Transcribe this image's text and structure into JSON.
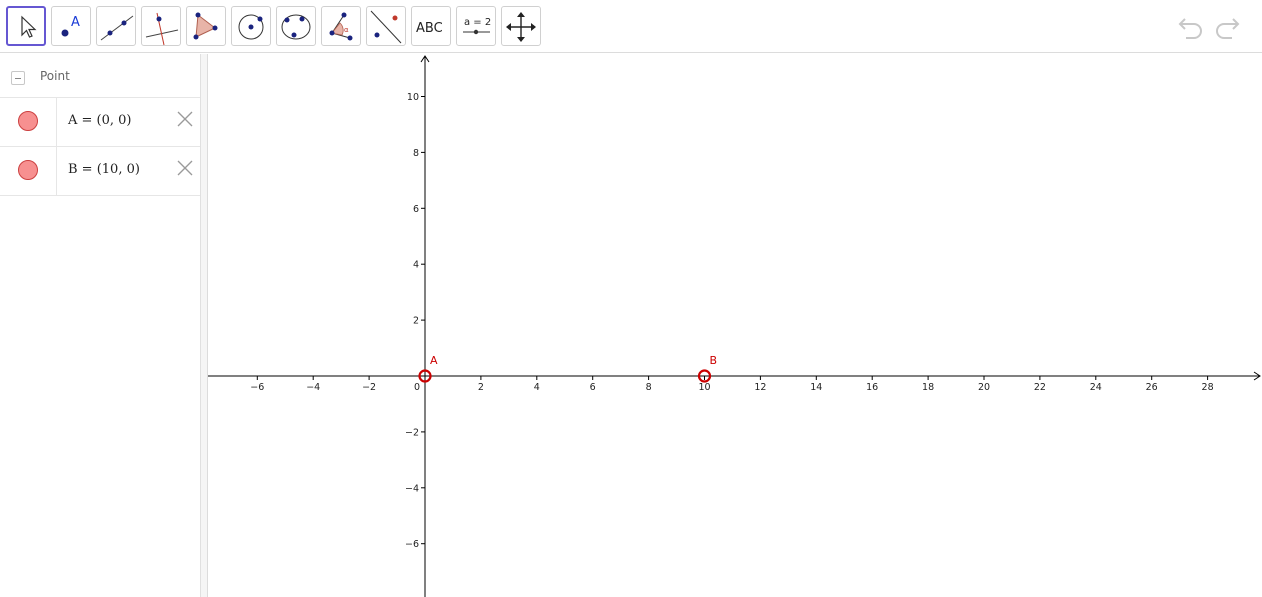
{
  "toolbar": {
    "tools": [
      {
        "name": "move-tool",
        "selected": true
      },
      {
        "name": "point-tool"
      },
      {
        "name": "line-tool"
      },
      {
        "name": "perpendicular-line-tool"
      },
      {
        "name": "polygon-tool"
      },
      {
        "name": "circle-center-point-tool"
      },
      {
        "name": "circle-three-points-tool"
      },
      {
        "name": "angle-tool"
      },
      {
        "name": "reflect-tool"
      },
      {
        "name": "text-tool",
        "label": "ABC"
      },
      {
        "name": "slider-tool",
        "label": "a = 2"
      },
      {
        "name": "move-graphics-view-tool"
      }
    ],
    "point_tool_label": "A"
  },
  "algebra": {
    "group_label": "Point",
    "items": [
      {
        "text": "A = (0, 0)"
      },
      {
        "text": "B = (10, 0)"
      }
    ]
  },
  "graphics": {
    "x_ticks": [
      "−6",
      "−4",
      "−2",
      "0",
      "2",
      "4",
      "6",
      "8",
      "10",
      "12",
      "14",
      "16",
      "18",
      "20",
      "22",
      "24",
      "26",
      "28"
    ],
    "y_ticks": [
      "10",
      "8",
      "6",
      "4",
      "2",
      "−2",
      "−4",
      "−6"
    ],
    "x_values": [
      -6,
      -4,
      -2,
      0,
      2,
      4,
      6,
      8,
      10,
      12,
      14,
      16,
      18,
      20,
      22,
      24,
      26,
      28
    ],
    "y_values": [
      10,
      8,
      6,
      4,
      2,
      -2,
      -4,
      -6
    ],
    "points": [
      {
        "label": "A",
        "x": 0,
        "y": 0
      },
      {
        "label": "B",
        "x": 10,
        "y": 0
      }
    ],
    "point_color": "#cc0000"
  },
  "colors": {
    "selected_tool_border": "#6557d2",
    "point_fill": "#f79090"
  }
}
